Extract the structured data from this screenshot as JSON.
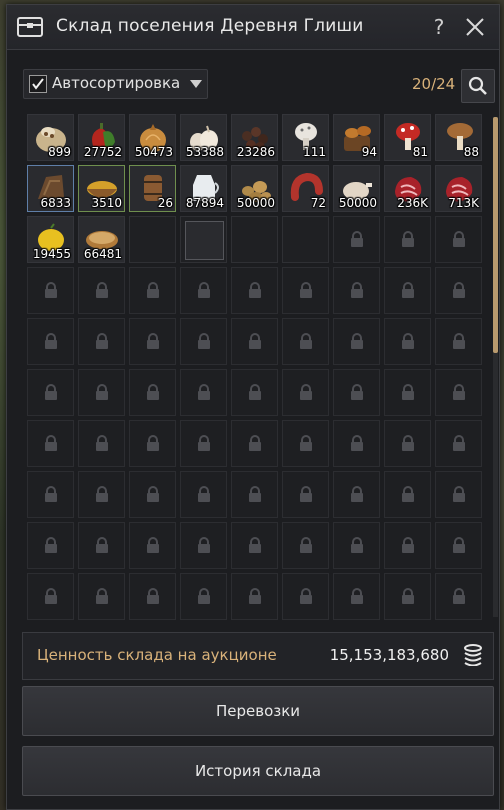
{
  "window": {
    "title": "Склад поселения Деревня Глиши",
    "help_label": "?"
  },
  "toolbar": {
    "autosort_label": "Автосортировка",
    "autosort_checked": true,
    "capacity": "20/24"
  },
  "slots": [
    {
      "icon": "sack-icon",
      "qty": "899",
      "border": "normal"
    },
    {
      "icon": "pepper-icon",
      "qty": "27752",
      "border": "normal"
    },
    {
      "icon": "onion-icon",
      "qty": "50473",
      "border": "normal"
    },
    {
      "icon": "garlic-icon",
      "qty": "53388",
      "border": "normal"
    },
    {
      "icon": "beans-icon",
      "qty": "23286",
      "border": "normal"
    },
    {
      "icon": "mushroom-white-icon",
      "qty": "111",
      "border": "normal"
    },
    {
      "icon": "mushroom-stump-icon",
      "qty": "94",
      "border": "normal"
    },
    {
      "icon": "mushroom-red-icon",
      "qty": "81",
      "border": "normal"
    },
    {
      "icon": "mushroom-brown-icon",
      "qty": "88",
      "border": "normal"
    },
    {
      "icon": "hide-icon",
      "qty": "6833",
      "border": "blue"
    },
    {
      "icon": "bowl-icon",
      "qty": "3510",
      "border": "green"
    },
    {
      "icon": "barrel-icon",
      "qty": "26",
      "border": "green"
    },
    {
      "icon": "milk-icon",
      "qty": "87894",
      "border": "normal"
    },
    {
      "icon": "potatoes-icon",
      "qty": "50000",
      "border": "normal"
    },
    {
      "icon": "sausage-icon",
      "qty": "72",
      "border": "normal"
    },
    {
      "icon": "chicken-icon",
      "qty": "50000",
      "border": "normal"
    },
    {
      "icon": "meat-icon",
      "qty": "236K",
      "border": "normal"
    },
    {
      "icon": "meat-icon",
      "qty": "713K",
      "border": "normal"
    },
    {
      "icon": "lemon-icon",
      "qty": "19455",
      "border": "normal"
    },
    {
      "icon": "flour-bowl-icon",
      "qty": "66481",
      "border": "normal"
    }
  ],
  "colors": {
    "accent_gold": "#d9b27a",
    "panel": "#1c1d20",
    "scroll_thumb": "#b99a6e"
  },
  "footer": {
    "value_label": "Ценность склада на аукционе",
    "value_amount": "15,153,183,680",
    "transport_button": "Перевозки",
    "history_button": "История склада"
  }
}
